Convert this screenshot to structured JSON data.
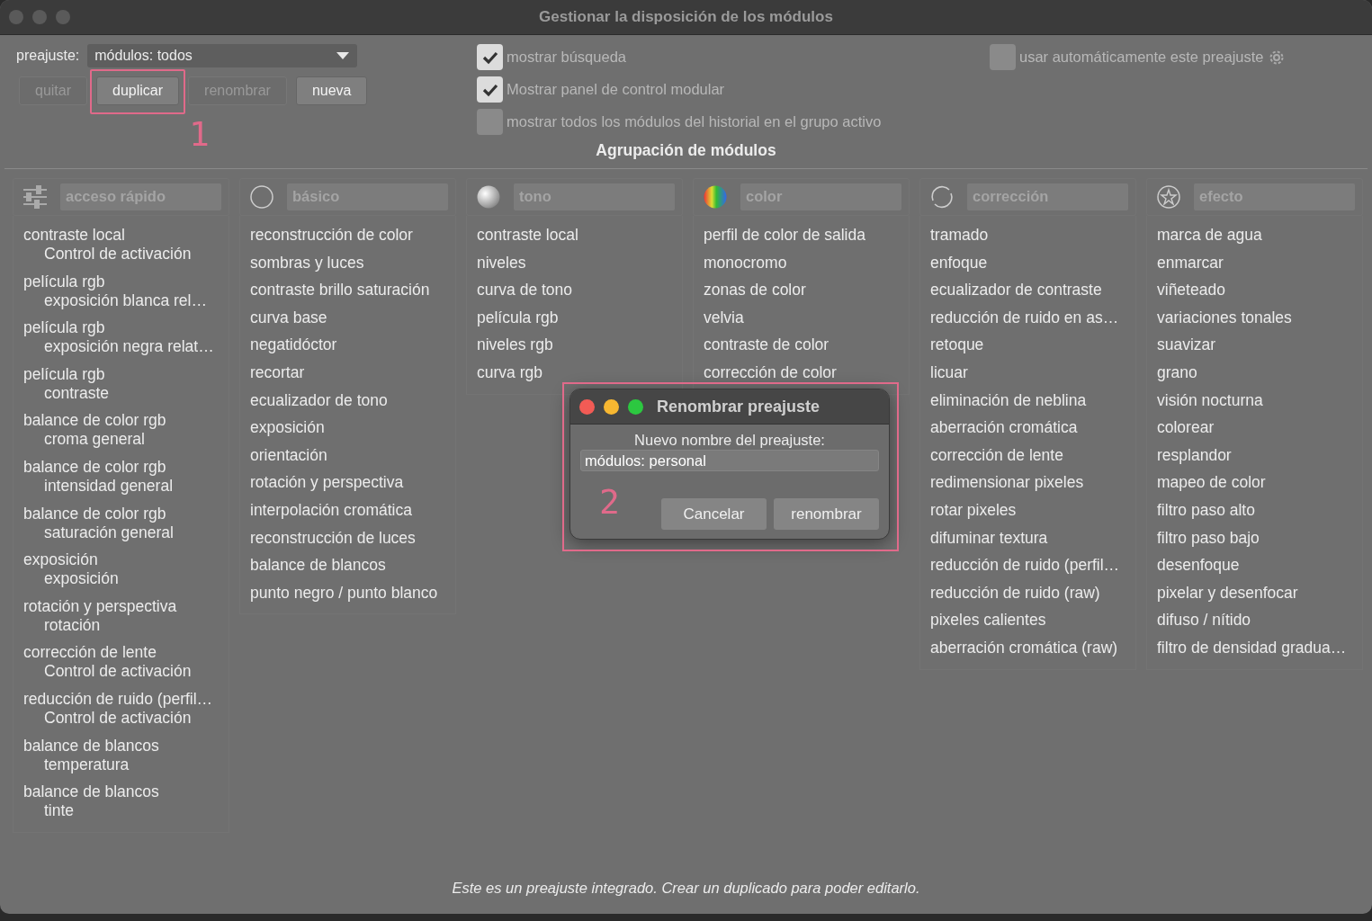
{
  "window": {
    "title": "Gestionar la disposición de los módulos"
  },
  "preset": {
    "label": "preajuste:",
    "value": "módulos: todos"
  },
  "buttons": [
    {
      "label": "quitar",
      "disabled": true
    },
    {
      "label": "duplicar",
      "disabled": false
    },
    {
      "label": "renombrar",
      "disabled": true
    },
    {
      "label": "nueva",
      "disabled": false
    }
  ],
  "options": [
    {
      "label": "mostrar búsqueda",
      "checked": true
    },
    {
      "label": "Mostrar panel de control modular",
      "checked": true
    },
    {
      "label": "mostrar todos los módulos del historial en el grupo activo",
      "checked": false
    }
  ],
  "auto_option": {
    "label": "usar automáticamente este preajuste",
    "checked": false
  },
  "section_title": "Agrupación de módulos",
  "groups": [
    {
      "kind": "sliders",
      "name": "acceso rápido",
      "items": [
        {
          "label": "contraste local",
          "detail": "Control de activación"
        },
        {
          "label": "película rgb",
          "detail": "exposición blanca rel…"
        },
        {
          "label": "película rgb",
          "detail": "exposición negra relat…"
        },
        {
          "label": "película rgb",
          "detail": "contraste"
        },
        {
          "label": "balance de color rgb",
          "detail": "croma general"
        },
        {
          "label": "balance de color rgb",
          "detail": "intensidad general"
        },
        {
          "label": "balance de color rgb",
          "detail": "saturación general"
        },
        {
          "label": "exposición",
          "detail": "exposición"
        },
        {
          "label": "rotación y perspectiva",
          "detail": "rotación"
        },
        {
          "label": "corrección de lente",
          "detail": "Control de activación"
        },
        {
          "label": "reducción de ruido (perfil…",
          "detail": "Control de activación"
        },
        {
          "label": "balance de blancos",
          "detail": "temperatura"
        },
        {
          "label": "balance de blancos",
          "detail": "tinte"
        }
      ]
    },
    {
      "kind": "circle",
      "name": "básico",
      "items": [
        {
          "label": "reconstrucción de color"
        },
        {
          "label": "sombras y luces"
        },
        {
          "label": "contraste brillo saturación"
        },
        {
          "label": "curva base"
        },
        {
          "label": "negatidóctor"
        },
        {
          "label": "recortar"
        },
        {
          "label": "ecualizador de tono"
        },
        {
          "label": "exposición"
        },
        {
          "label": "orientación"
        },
        {
          "label": "rotación y perspectiva"
        },
        {
          "label": "interpolación cromática"
        },
        {
          "label": "reconstrucción de luces"
        },
        {
          "label": "balance de blancos"
        },
        {
          "label": "punto negro / punto blanco"
        }
      ]
    },
    {
      "kind": "sphere",
      "name": "tono",
      "items": [
        {
          "label": "contraste local"
        },
        {
          "label": "niveles"
        },
        {
          "label": "curva de tono"
        },
        {
          "label": "película rgb"
        },
        {
          "label": "niveles rgb"
        },
        {
          "label": "curva rgb"
        }
      ]
    },
    {
      "kind": "rainbow",
      "name": "color",
      "items": [
        {
          "label": "perfil de color de salida"
        },
        {
          "label": "monocromo"
        },
        {
          "label": "zonas de color"
        },
        {
          "label": "velvia"
        },
        {
          "label": "contraste de color"
        },
        {
          "label": "corrección de color"
        }
      ]
    },
    {
      "kind": "arc",
      "name": "corrección",
      "items": [
        {
          "label": "tramado"
        },
        {
          "label": "enfoque"
        },
        {
          "label": "ecualizador de contraste"
        },
        {
          "label": "reducción de ruido en as…"
        },
        {
          "label": "retoque"
        },
        {
          "label": "licuar"
        },
        {
          "label": "eliminación de neblina"
        },
        {
          "label": "aberración cromática"
        },
        {
          "label": "corrección de lente"
        },
        {
          "label": "redimensionar pixeles"
        },
        {
          "label": "rotar pixeles"
        },
        {
          "label": "difuminar textura"
        },
        {
          "label": "reducción de ruido (perfil…"
        },
        {
          "label": "reducción de ruido (raw)"
        },
        {
          "label": "pixeles calientes"
        },
        {
          "label": "aberración cromática (raw)"
        }
      ]
    },
    {
      "kind": "star",
      "name": "efecto",
      "items": [
        {
          "label": "marca de agua"
        },
        {
          "label": "enmarcar"
        },
        {
          "label": "viñeteado"
        },
        {
          "label": "variaciones tonales"
        },
        {
          "label": "suavizar"
        },
        {
          "label": "grano"
        },
        {
          "label": "visión nocturna"
        },
        {
          "label": "colorear"
        },
        {
          "label": "resplandor"
        },
        {
          "label": "mapeo de color"
        },
        {
          "label": "filtro paso alto"
        },
        {
          "label": "filtro paso bajo"
        },
        {
          "label": "desenfoque"
        },
        {
          "label": "pixelar y desenfocar"
        },
        {
          "label": "difuso / nítido"
        },
        {
          "label": "filtro de densidad gradua…"
        }
      ]
    }
  ],
  "status": "Este es un preajuste integrado. Crear un duplicado para poder editarlo.",
  "dialog": {
    "title": "Renombrar preajuste",
    "prompt": "Nuevo nombre del preajuste:",
    "value": "módulos: personal",
    "buttons": [
      "Cancelar",
      "renombrar"
    ]
  },
  "annotations": [
    "1",
    "2"
  ]
}
